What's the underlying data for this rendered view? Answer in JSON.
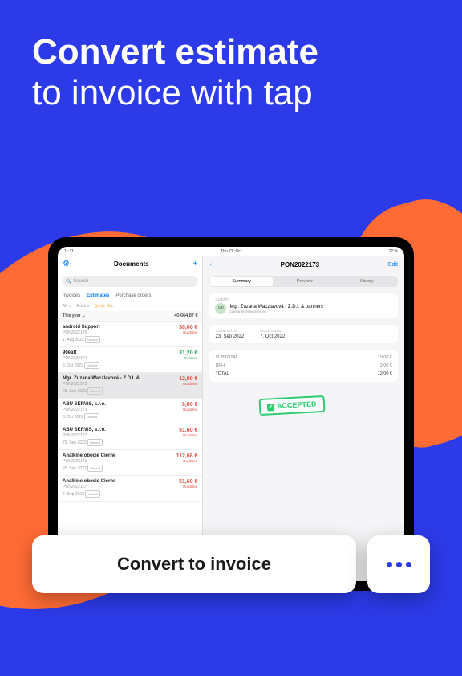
{
  "headline": {
    "bold": "Convert estimate",
    "rest": "to invoice with tap"
  },
  "statusbar": {
    "time": "11:11",
    "date": "Thu 27. Oct",
    "battery": "72 %"
  },
  "leftNav": {
    "title": "Documents"
  },
  "search": {
    "placeholder": "Search"
  },
  "tabs": {
    "invoices": "Invoices",
    "estimates": "Estimates",
    "po": "Purchase orders"
  },
  "filters": {
    "all": "All",
    "actions": "Actions",
    "quote": "Quote Rec"
  },
  "summary": {
    "period": "This year",
    "total": "40.664,87 €"
  },
  "items": [
    {
      "name": "android Support",
      "id": "PON2022175",
      "date": "1. Aug 2022",
      "amt": "30,00 €",
      "cls": "red",
      "status": "Outdated",
      "badge": "Unsent"
    },
    {
      "name": "90eaft",
      "id": "PON2022174",
      "date": "3. Oct 2022",
      "amt": "31,20 €",
      "cls": "green",
      "status": "Invoiced",
      "badge": "Unsent",
      "sg": true
    },
    {
      "name": "Mgr. Zuzana Waczlavová - Z.D.I. &...",
      "id": "PON2022173",
      "date": "23. Sep 2022",
      "amt": "12,00 €",
      "cls": "red",
      "status": "Outdated",
      "badge": "Unsent",
      "sel": true
    },
    {
      "name": "ABU SERVIS, s.r.o.",
      "id": "PON2022173",
      "date": "3. Oct 2022",
      "amt": "6,00 €",
      "cls": "red",
      "status": "Outdated",
      "badge": "Unsent"
    },
    {
      "name": "ABU SERVIS, s.r.o.",
      "id": "PON2022172",
      "date": "22. Sep 2022",
      "amt": "51,60 €",
      "cls": "red",
      "status": "Outdated",
      "badge": "Unsent"
    },
    {
      "name": "Analkine obocie Cierne",
      "id": "PON2022171",
      "date": "20. Sep 2022",
      "amt": "112,68 €",
      "cls": "red",
      "status": "Outdated",
      "badge": "Unsent"
    },
    {
      "name": "Analkine obocie Cierne",
      "id": "PON2022167",
      "date": "7. Sep 2022",
      "amt": "51,60 €",
      "cls": "red",
      "status": "Outdated",
      "badge": "Unsent"
    }
  ],
  "detail": {
    "title": "PON2022173",
    "edit": "Edit",
    "seg": {
      "summary": "Summary",
      "preview": "Preview",
      "history": "History"
    },
    "clientLabel": "CLIENT",
    "clientInitials": "MP",
    "clientName": "Mgr. Zuzana Waczlavová - Z.D.I. & partners",
    "clientEmail": "zdielanie@iinvoices.eu",
    "issueLabel": "ISSUE DATE",
    "issueDate": "23. Sep 2022",
    "validLabel": "VALID UNTIL",
    "validDate": "7. Oct 2022",
    "subtotalLabel": "SUBTOTAL",
    "subtotal": "10,00 €",
    "taxLabel": "DPH",
    "tax": "2,00 €",
    "totalLabel": "TOTAL",
    "total": "12,00 €",
    "convertLink": "Convert to invoice"
  },
  "stamp": "ACCEPTED",
  "cta": "Convert to invoice"
}
